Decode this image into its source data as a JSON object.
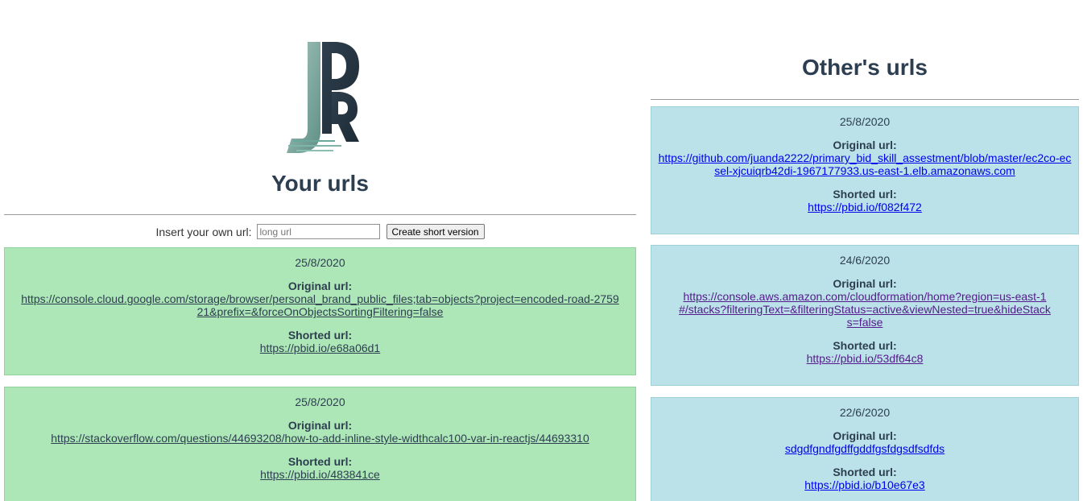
{
  "logo": {
    "text": "JPR"
  },
  "your_urls": {
    "title": "Your urls",
    "insert_label": "Insert your own url:",
    "input_placeholder": "long url",
    "input_value": "",
    "create_button": "Create short version",
    "cards": [
      {
        "date": "25/8/2020",
        "original_label": "Original url:",
        "original_url": "https://console.cloud.google.com/storage/browser/personal_brand_public_files;tab=objects?project=encoded-road-275921&prefix=&forceOnObjectsSortingFiltering=false",
        "short_label": "Shorted url:",
        "short_url": "https://pbid.io/e68a06d1"
      },
      {
        "date": "25/8/2020",
        "original_label": "Original url:",
        "original_url": "https://stackoverflow.com/questions/44693208/how-to-add-inline-style-widthcalc100-var-in-reactjs/44693310",
        "short_label": "Shorted url:",
        "short_url": "https://pbid.io/483841ce"
      }
    ]
  },
  "others_urls": {
    "title": "Other's urls",
    "cards": [
      {
        "date": "25/8/2020",
        "original_label": "Original url:",
        "original_url": "https://github.com/juanda2222/primary_bid_skill_assestment/blob/master/ec2co-ecsel-xjcuiqrb42di-1967177933.us-east-1.elb.amazonaws.com",
        "short_label": "Shorted url:",
        "short_url": "https://pbid.io/f082f472"
      },
      {
        "date": "24/6/2020",
        "original_label": "Original url:",
        "original_url": "https://console.aws.amazon.com/cloudformation/home?region=us-east-1#/stacks?filteringText=&filteringStatus=active&viewNested=true&hideStacks=false",
        "short_label": "Shorted url:",
        "short_url": "https://pbid.io/53df64c8"
      },
      {
        "date": "22/6/2020",
        "original_label": "Original url:",
        "original_url": "sdgdfgndfgdffgddfgsfdgsdfsdfds",
        "short_label": "Shorted url:",
        "short_url": "https://pbid.io/b10e67e3"
      }
    ]
  },
  "colors": {
    "heading": "#2c3e50",
    "your_card_bg": "#aee7b7",
    "other_card_bg": "#bae2e8",
    "link_blue": "#0000ee",
    "link_visited": "#551a8b"
  }
}
